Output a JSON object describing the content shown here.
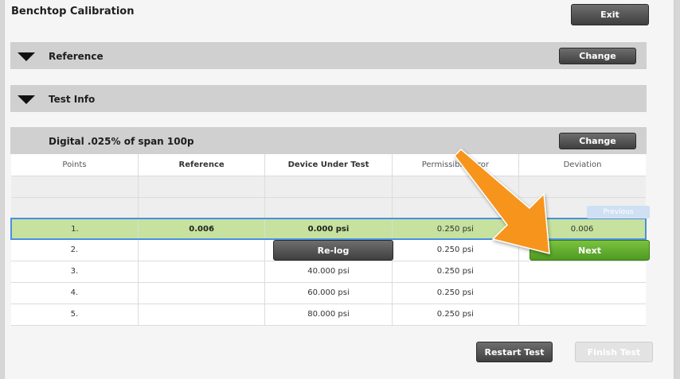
{
  "header": {
    "title": "Benchtop Calibration",
    "exit_label": "Exit"
  },
  "sections": {
    "reference": {
      "label": "Reference",
      "change_label": "Change"
    },
    "test_info": {
      "label": "Test Info"
    },
    "procedure": {
      "label": "Digital .025% of span 100p",
      "change_label": "Change"
    }
  },
  "table": {
    "columns": [
      "Points",
      "Reference",
      "Device Under Test",
      "Permissible Error",
      "Deviation"
    ],
    "rows": [
      {
        "point": "1.",
        "reference": "0.006",
        "dut": "0.000 psi",
        "error": "0.250 psi",
        "deviation": "0.006"
      },
      {
        "point": "2.",
        "reference": "",
        "dut": "",
        "error": "0.250 psi",
        "deviation": ""
      },
      {
        "point": "3.",
        "reference": "",
        "dut": "40.000 psi",
        "error": "0.250 psi",
        "deviation": ""
      },
      {
        "point": "4.",
        "reference": "",
        "dut": "60.000 psi",
        "error": "0.250 psi",
        "deviation": ""
      },
      {
        "point": "5.",
        "reference": "",
        "dut": "80.000 psi",
        "error": "0.250 psi",
        "deviation": ""
      }
    ]
  },
  "buttons": {
    "relog": "Re-log",
    "next": "Next",
    "previous": "Previous",
    "restart": "Restart Test",
    "finish": "Finish Test"
  },
  "colors": {
    "active_row": "#c6e29e",
    "selection_border": "#4a90e2",
    "next_green": "#5aa82b",
    "arrow_orange": "#f7941d"
  },
  "icons": {
    "section_toggle": "triangle-down-icon",
    "annotation": "orange-arrow-icon"
  }
}
